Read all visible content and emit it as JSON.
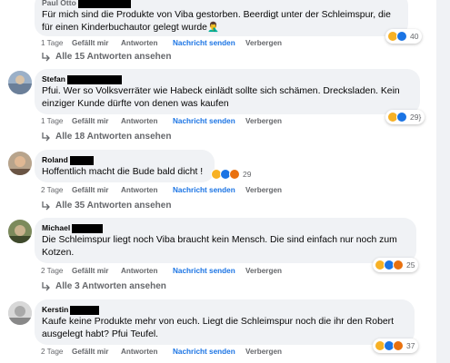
{
  "comments": [
    {
      "name": "Paul Otto",
      "text": "Für mich sind die Produkte von Viba gestorben. Beerdigt unter der Schleimspur, die für einen Kinderbuchautor gelegt wurde🤦‍♂️",
      "time": "1 Tage",
      "like": "Gefällt mir",
      "reply": "Antworten",
      "message": "Nachricht senden",
      "hide": "Verbergen",
      "reaction_count": "40",
      "replies_label": "Alle 15 Antworten ansehen"
    },
    {
      "name": "Stefan",
      "text": "Pfui. Wer so Volksverräter wie Habeck einlädt sollte sich schämen. Drecksladen. Kein einziger Kunde dürfte von denen was kaufen",
      "time": "1 Tage",
      "like": "Gefällt mir",
      "reply": "Antworten",
      "message": "Nachricht senden",
      "hide": "Verbergen",
      "reaction_count": "29",
      "replies_label": "Alle 18 Antworten ansehen"
    },
    {
      "name": "Roland",
      "text": "Hoffentlich macht die Bude bald dicht !",
      "time": "2 Tage",
      "like": "Gefällt mir",
      "reply": "Antworten",
      "message": "Nachricht senden",
      "hide": "Verbergen",
      "reaction_count": "29",
      "replies_label": "Alle 35 Antworten ansehen"
    },
    {
      "name": "Michael",
      "text": "Die Schleimspur liegt noch Viba braucht kein Mensch. Die sind einfach nur noch zum Kotzen.",
      "time": "2 Tage",
      "like": "Gefällt mir",
      "reply": "Antworten",
      "message": "Nachricht senden",
      "hide": "Verbergen",
      "reaction_count": "25",
      "replies_label": "Alle 3 Antworten ansehen"
    },
    {
      "name": "Kerstin",
      "text": "Kaufe keine Produkte mehr von euch. Liegt die Schleimspur noch die ihr den Robert ausgelegt habt? Pfui Teufel.",
      "time": "2 Tage",
      "like": "Gefällt mir",
      "reply": "Antworten",
      "message": "Nachricht senden",
      "hide": "Verbergen",
      "reaction_count": "37"
    }
  ],
  "icons": {
    "reply_arrow": "reply-arrow-icon",
    "reactions": [
      "haha",
      "like",
      "angry"
    ]
  },
  "colors": {
    "bubble": "#f0f2f5",
    "link_blue": "#1b74e4",
    "meta_gray": "#65676b"
  }
}
